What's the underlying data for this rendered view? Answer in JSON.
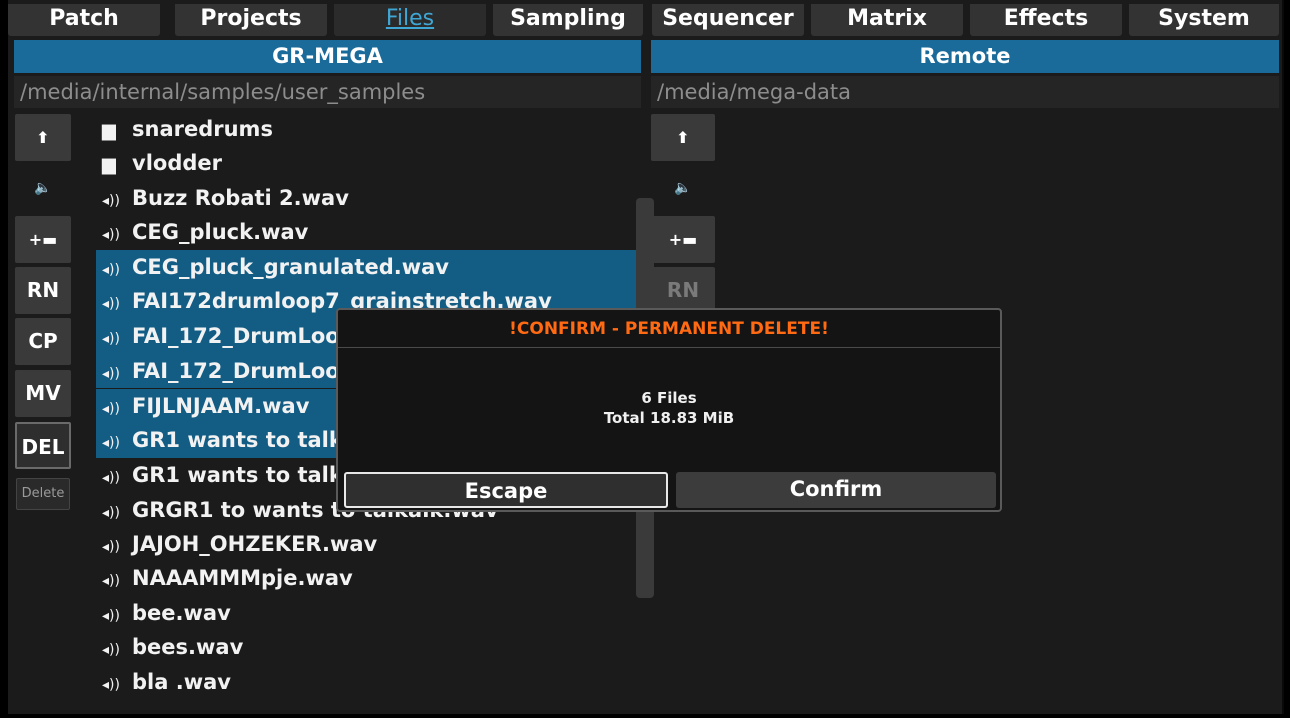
{
  "tabs": [
    {
      "label": "Patch",
      "active": false
    },
    {
      "label": "Projects",
      "active": false
    },
    {
      "label": "Files",
      "active": true
    },
    {
      "label": "Sampling",
      "active": false
    },
    {
      "label": "Sequencer",
      "active": false
    },
    {
      "label": "Matrix",
      "active": false
    },
    {
      "label": "Effects",
      "active": false
    },
    {
      "label": "System",
      "active": false
    }
  ],
  "left_pane": {
    "title": "GR-MEGA",
    "path": "/media/internal/samples/user_samples",
    "buttons": {
      "up": "🠉",
      "speaker": "🔈",
      "new_folder": "+📁",
      "rename": "RN",
      "copy": "CP",
      "move": "MV",
      "delete": "DEL",
      "delete_hint": "Delete"
    },
    "files": [
      {
        "name": "snaredrums",
        "type": "folder",
        "selected": false
      },
      {
        "name": "vlodder",
        "type": "folder",
        "selected": false
      },
      {
        "name": "Buzz Robati 2.wav",
        "type": "audio",
        "selected": false
      },
      {
        "name": "CEG_pluck.wav",
        "type": "audio",
        "selected": false
      },
      {
        "name": "CEG_pluck_granulated.wav",
        "type": "audio",
        "selected": true
      },
      {
        "name": "FAI172drumloop7_grainstretch.wav",
        "type": "audio",
        "selected": true
      },
      {
        "name": "FAI_172_DrumLoop",
        "type": "audio",
        "selected": true
      },
      {
        "name": "FAI_172_DrumLoop",
        "type": "audio",
        "selected": true
      },
      {
        "name": "FIJLNJAAM.wav",
        "type": "audio",
        "selected": true
      },
      {
        "name": "GR1 wants to talk",
        "type": "audio",
        "selected": true
      },
      {
        "name": "GR1 wants to talk",
        "type": "audio",
        "selected": false
      },
      {
        "name": "GRGR1 to wants to talkalk.wav",
        "type": "audio",
        "selected": false
      },
      {
        "name": "JAJOH_OHZEKER.wav",
        "type": "audio",
        "selected": false
      },
      {
        "name": "NAAAMMMpje.wav",
        "type": "audio",
        "selected": false
      },
      {
        "name": "bee.wav",
        "type": "audio",
        "selected": false
      },
      {
        "name": "bees.wav",
        "type": "audio",
        "selected": false
      },
      {
        "name": "bla .wav",
        "type": "audio",
        "selected": false
      }
    ]
  },
  "right_pane": {
    "title": "Remote",
    "path": "/media/mega-data",
    "buttons": {
      "up": "🠉",
      "speaker": "🔈",
      "new_folder": "+📁",
      "rename": "RN"
    }
  },
  "dialog": {
    "title": "!CONFIRM - PERMANENT DELETE!",
    "file_count": "6 Files",
    "total_size": "Total 18.83 MiB",
    "escape_label": "Escape",
    "confirm_label": "Confirm"
  },
  "colors": {
    "accent_blue": "#1a6b9a",
    "selection": "#135d85",
    "active_tab": "#3fa7d6",
    "warning": "#ff6a13"
  }
}
